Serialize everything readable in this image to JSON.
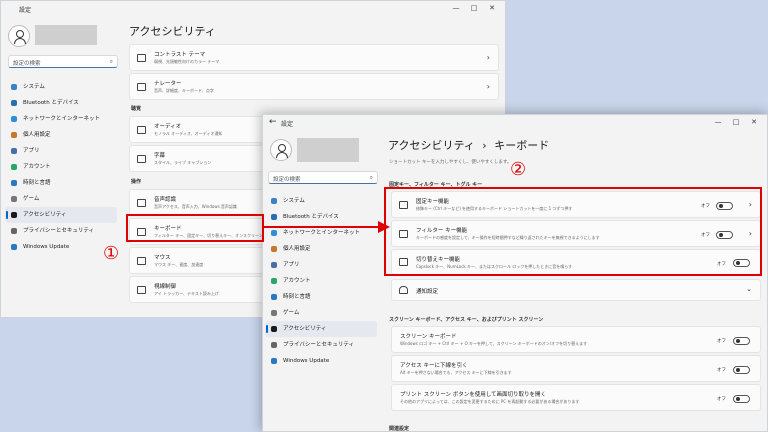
{
  "colors": {
    "accent": "#0067c0",
    "annotation": "#e00000"
  },
  "window1": {
    "title": "設定",
    "controls": [
      "—",
      "□",
      "✕"
    ],
    "search_placeholder": "設定の検索",
    "nav": [
      {
        "label": "システム",
        "icon": "monitor-icon",
        "color": "#3b82c4"
      },
      {
        "label": "Bluetooth とデバイス",
        "icon": "bluetooth-icon",
        "color": "#2a6fb0"
      },
      {
        "label": "ネットワークとインターネット",
        "icon": "wifi-icon",
        "color": "#2f8fd8"
      },
      {
        "label": "個人用設定",
        "icon": "brush-icon",
        "color": "#c9772a"
      },
      {
        "label": "アプリ",
        "icon": "apps-icon",
        "color": "#4a6fa5"
      },
      {
        "label": "アカウント",
        "icon": "account-icon",
        "color": "#2aa56b"
      },
      {
        "label": "時刻と言語",
        "icon": "globe-icon",
        "color": "#2a78c4"
      },
      {
        "label": "ゲーム",
        "icon": "gamepad-icon",
        "color": "#777777"
      },
      {
        "label": "アクセシビリティ",
        "icon": "accessibility-icon",
        "color": "#1a1a1a"
      },
      {
        "label": "プライバシーとセキュリティ",
        "icon": "shield-icon",
        "color": "#666666"
      },
      {
        "label": "Windows Update",
        "icon": "update-icon",
        "color": "#2a78c4"
      }
    ],
    "page_title": "アクセシビリティ",
    "cards_top": [
      {
        "title": "コントラスト テーマ",
        "sub": "弱視、光過敏性向けのカラー テーマ"
      },
      {
        "title": "ナレーター",
        "sub": "音声、詳細度、キーボード、点字"
      }
    ],
    "section_audio": "聴覚",
    "cards_audio": [
      {
        "title": "オーディオ",
        "sub": "モノラル オーディオ、オーディオ通知"
      },
      {
        "title": "字幕",
        "sub": "スタイル、ライブ キャプション"
      }
    ],
    "section_interaction": "操作",
    "cards_interaction": [
      {
        "title": "音声認識",
        "sub": "音声アクセス、音声入力、Windows 音声認識"
      },
      {
        "title": "キーボード",
        "sub": "フィルター キー、固定キー、切り替えキー、オンスクリーン キーボード"
      },
      {
        "title": "マウス",
        "sub": "マウス キー、速度、加速度"
      },
      {
        "title": "視線制御",
        "sub": "アイ トラッカー、テキスト読み上げ"
      }
    ]
  },
  "window2": {
    "title": "設定",
    "back": "←",
    "controls": [
      "—",
      "□",
      "✕"
    ],
    "search_placeholder": "設定の検索",
    "nav": [
      {
        "label": "システム",
        "icon": "monitor-icon",
        "color": "#3b82c4"
      },
      {
        "label": "Bluetooth とデバイス",
        "icon": "bluetooth-icon",
        "color": "#2a6fb0"
      },
      {
        "label": "ネットワークとインターネット",
        "icon": "wifi-icon",
        "color": "#2f8fd8"
      },
      {
        "label": "個人用設定",
        "icon": "brush-icon",
        "color": "#c9772a"
      },
      {
        "label": "アプリ",
        "icon": "apps-icon",
        "color": "#4a6fa5"
      },
      {
        "label": "アカウント",
        "icon": "account-icon",
        "color": "#2aa56b"
      },
      {
        "label": "時刻と言語",
        "icon": "globe-icon",
        "color": "#2a78c4"
      },
      {
        "label": "ゲーム",
        "icon": "gamepad-icon",
        "color": "#777777"
      },
      {
        "label": "アクセシビリティ",
        "icon": "accessibility-icon",
        "color": "#1a1a1a"
      },
      {
        "label": "プライバシーとセキュリティ",
        "icon": "shield-icon",
        "color": "#666666"
      },
      {
        "label": "Windows Update",
        "icon": "update-icon",
        "color": "#2a78c4"
      }
    ],
    "breadcrumb_parent": "アクセシビリティ",
    "breadcrumb_sep": "›",
    "breadcrumb_current": "キーボード",
    "hint": "ショートカット キーを入力しやすくし、使いやすくします。",
    "section1": "固定キー、フィルター キー、トグル キー",
    "keys": [
      {
        "title": "固定キー機能",
        "sub": "修飾キー (Ctrl キーなど) を使用するキーボード ショートカットを一度に 1 つずつ押す",
        "state": "オフ",
        "chevron": "›"
      },
      {
        "title": "フィルター キー機能",
        "sub": "キーボードの感度を設定して、キー操作を短時間押すなど繰り返されたキーを無視できるようにします",
        "state": "オフ",
        "chevron": "›"
      },
      {
        "title": "切り替えキー機能",
        "sub": "Capslock キー、NumLock キー、またはスクロール ロックを押したときに音を鳴らす",
        "state": "オフ"
      }
    ],
    "notify": {
      "title": "通知設定",
      "chevron": "⌄"
    },
    "section2": "スクリーン キーボード、アクセス キー、およびプリント スクリーン",
    "lower": [
      {
        "title": "スクリーン キーボード",
        "sub": "Windows ロゴ キー + Ctrl キー + O キーを押して、スクリーン キーボードのオン/オフを切り替えます",
        "state": "オフ"
      },
      {
        "title": "アクセス キーに下線を引く",
        "sub": "Alt キーを押さない場合でも、アクセス キーに下線を引きます",
        "state": "オフ"
      },
      {
        "title": "プリント スクリーン ボタンを使用して画面切り取りを開く",
        "sub": "その他のアプリによっては、この設定を変更するために PC を再起動する必要がある場合があります",
        "state": "オフ"
      }
    ],
    "section3": "関連設定"
  },
  "annotations": {
    "step1": "①",
    "step2": "②"
  }
}
